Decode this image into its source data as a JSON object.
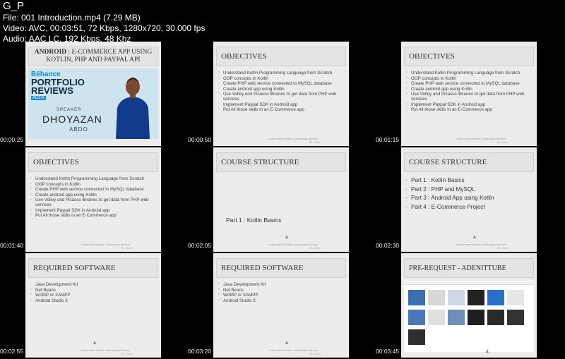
{
  "header": {
    "title": "G_P",
    "file_line": "File: 001 Introduction.mp4 (7.29 MB)",
    "video_line": "Video: AVC, 00:03:51, 72 Kbps, 1280x720, 30.000 fps",
    "audio_line": "Audio: AAC LC, 192 Kbps, 48 Khz"
  },
  "watermark": "Unlicensed Version\nUnlicensed Version",
  "logo_text": "E1 Video",
  "tiles": [
    {
      "timestamp": "00:00:25",
      "title_bold": "ANDROID",
      "title_rest": ": E-COMMERCE APP USING KOTLIN, PHP AND PAYPAL API",
      "behance": "Bēhance",
      "portfolio": "PORTFOLIO",
      "reviews": "REVIEWS",
      "aden": "ADEN",
      "speaker_label": "SPEAKER",
      "speaker_first": "DHOYAZAN",
      "speaker_last": "ABDO"
    },
    {
      "timestamp": "00:00:50",
      "title": "OBJECTIVES",
      "items": [
        "Understand Kotlin Programming Language from Scratch",
        "OOP concepts in Kotlin",
        "Create PHP web service connected to MySQL database",
        "Create android app using Kotlin",
        "Use Volley and Picasso libraries to get data from PHP web services",
        "Implement Paypal SDK in Android app",
        "Put All those skills in an E-Commerce app"
      ]
    },
    {
      "timestamp": "00:01:15",
      "title": "OBJECTIVES",
      "items": [
        "Understand Kotlin Programming Language from Scratch",
        "OOP concepts in Kotlin",
        "Create PHP web service connected to MySQL database",
        "Create android app using Kotlin",
        "Use Volley and Picasso libraries to get data from PHP web services",
        "Implement Paypal SDK in Android app",
        "Put All those skills in an E-Commerce app"
      ]
    },
    {
      "timestamp": "00:01:40",
      "title": "OBJECTIVES",
      "items": [
        "Understand Kotlin Programming Language from Scratch",
        "OOP concepts in Kotlin",
        "Create PHP web service connected to MySQL database",
        "Create android app using Kotlin",
        "Use Volley and Picasso libraries to get data from PHP web services",
        "Implement Paypal SDK in Android app",
        "Put All those skills in an E-Commerce app"
      ]
    },
    {
      "timestamp": "00:02:05",
      "title": "COURSE STRUCTURE",
      "part": "Part 1 : Kotlin Basics"
    },
    {
      "timestamp": "00:02:30",
      "title": "COURSE STRUCTURE",
      "items": [
        "Part 1 : Kotlin Basics",
        "Part 2 : PHP and MySQL",
        "Part 3 : Android App using Kotlin",
        "Part 4 : E-Commerce Project"
      ]
    },
    {
      "timestamp": "00:02:55",
      "title": "REQUIRED SOFTWARE",
      "items": [
        "Java Development Kit",
        "Net Beans",
        "WAMP or XAMPP",
        "Android Studio 3"
      ]
    },
    {
      "timestamp": "00:03:20",
      "title": "REQUIRED SOFTWARE",
      "items": [
        "Java Development Kit",
        "Net Beans",
        "WAMP or XAMPP",
        "Android Studio 3"
      ]
    },
    {
      "timestamp": "00:03:45",
      "title": "PRE-REQUEST - ADENITTUBE"
    }
  ]
}
